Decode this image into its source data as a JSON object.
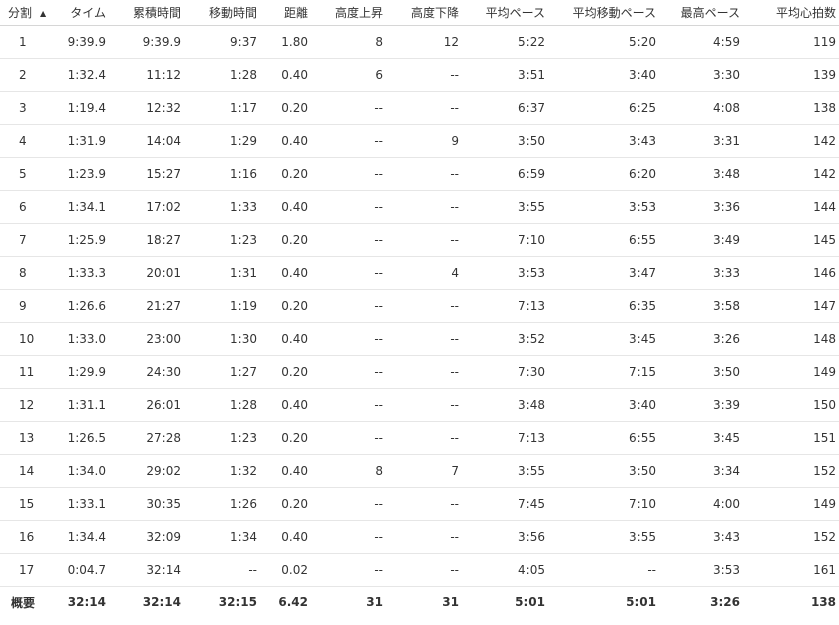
{
  "table": {
    "columns": [
      "分割",
      "タイム",
      "累積時間",
      "移動時間",
      "距離",
      "高度上昇",
      "高度下降",
      "平均ペース",
      "平均移動ペース",
      "最高ペース",
      "平均心拍数"
    ],
    "sort_column": "分割",
    "sort_direction": "ascending",
    "rows": [
      [
        "1",
        "9:39.9",
        "9:39.9",
        "9:37",
        "1.80",
        "8",
        "12",
        "5:22",
        "5:20",
        "4:59",
        "119"
      ],
      [
        "2",
        "1:32.4",
        "11:12",
        "1:28",
        "0.40",
        "6",
        "--",
        "3:51",
        "3:40",
        "3:30",
        "139"
      ],
      [
        "3",
        "1:19.4",
        "12:32",
        "1:17",
        "0.20",
        "--",
        "--",
        "6:37",
        "6:25",
        "4:08",
        "138"
      ],
      [
        "4",
        "1:31.9",
        "14:04",
        "1:29",
        "0.40",
        "--",
        "9",
        "3:50",
        "3:43",
        "3:31",
        "142"
      ],
      [
        "5",
        "1:23.9",
        "15:27",
        "1:16",
        "0.20",
        "--",
        "--",
        "6:59",
        "6:20",
        "3:48",
        "142"
      ],
      [
        "6",
        "1:34.1",
        "17:02",
        "1:33",
        "0.40",
        "--",
        "--",
        "3:55",
        "3:53",
        "3:36",
        "144"
      ],
      [
        "7",
        "1:25.9",
        "18:27",
        "1:23",
        "0.20",
        "--",
        "--",
        "7:10",
        "6:55",
        "3:49",
        "145"
      ],
      [
        "8",
        "1:33.3",
        "20:01",
        "1:31",
        "0.40",
        "--",
        "4",
        "3:53",
        "3:47",
        "3:33",
        "146"
      ],
      [
        "9",
        "1:26.6",
        "21:27",
        "1:19",
        "0.20",
        "--",
        "--",
        "7:13",
        "6:35",
        "3:58",
        "147"
      ],
      [
        "10",
        "1:33.0",
        "23:00",
        "1:30",
        "0.40",
        "--",
        "--",
        "3:52",
        "3:45",
        "3:26",
        "148"
      ],
      [
        "11",
        "1:29.9",
        "24:30",
        "1:27",
        "0.20",
        "--",
        "--",
        "7:30",
        "7:15",
        "3:50",
        "149"
      ],
      [
        "12",
        "1:31.1",
        "26:01",
        "1:28",
        "0.40",
        "--",
        "--",
        "3:48",
        "3:40",
        "3:39",
        "150"
      ],
      [
        "13",
        "1:26.5",
        "27:28",
        "1:23",
        "0.20",
        "--",
        "--",
        "7:13",
        "6:55",
        "3:45",
        "151"
      ],
      [
        "14",
        "1:34.0",
        "29:02",
        "1:32",
        "0.40",
        "8",
        "7",
        "3:55",
        "3:50",
        "3:34",
        "152"
      ],
      [
        "15",
        "1:33.1",
        "30:35",
        "1:26",
        "0.20",
        "--",
        "--",
        "7:45",
        "7:10",
        "4:00",
        "149"
      ],
      [
        "16",
        "1:34.4",
        "32:09",
        "1:34",
        "0.40",
        "--",
        "--",
        "3:56",
        "3:55",
        "3:43",
        "152"
      ],
      [
        "17",
        "0:04.7",
        "32:14",
        "--",
        "0.02",
        "--",
        "--",
        "4:05",
        "--",
        "3:53",
        "161"
      ]
    ],
    "summary": [
      "概要",
      "32:14",
      "32:14",
      "32:15",
      "6.42",
      "31",
      "31",
      "5:01",
      "5:01",
      "3:26",
      "138"
    ]
  },
  "icons": {
    "sort_arrow": "sort-ascending-icon"
  },
  "colors": {
    "text": "#333333",
    "row_border": "#e6e6e6",
    "background": "#ffffff"
  }
}
